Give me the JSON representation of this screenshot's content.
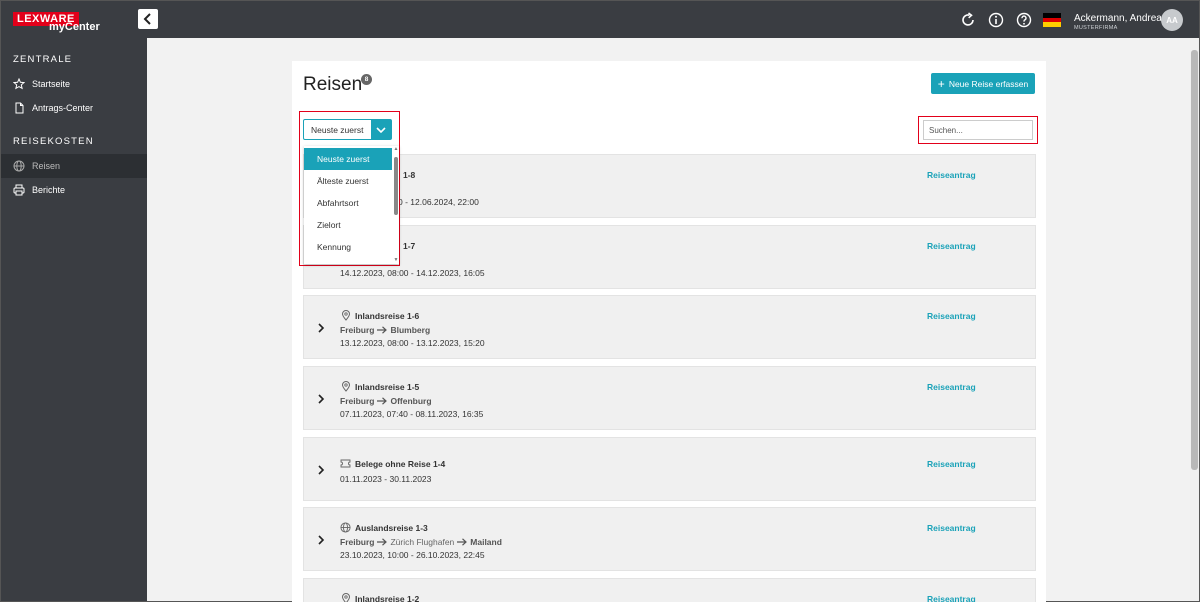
{
  "topbar": {
    "logo_lex": "LEXWARE",
    "logo_my": "myCenter",
    "user_name": "Ackermann, Andrea",
    "user_company": "MUSTERFIRMA",
    "avatar_initials": "AA"
  },
  "sidebar": {
    "section1": "ZENTRALE",
    "startseite": "Startseite",
    "antrags_center": "Antrags-Center",
    "section2": "REISEKOSTEN",
    "reisen": "Reisen",
    "berichte": "Berichte"
  },
  "page": {
    "title": "Reisen",
    "count": "8",
    "new_button": "Neue Reise erfassen"
  },
  "sort": {
    "selected": "Neuste zuerst",
    "options": [
      "Neuste zuerst",
      "Älteste zuerst",
      "Abfahrtsort",
      "Zielort",
      "Kennung"
    ]
  },
  "search": {
    "placeholder": "Suchen..."
  },
  "trips": [
    {
      "name": "1-8",
      "route_from": "",
      "route_to": "",
      "dates": "0 - 12.06.2024, 22:00",
      "link": "Reiseantrag"
    },
    {
      "name": "1-7",
      "route_from": "",
      "route_to": "",
      "dates": "14.12.2023, 08:00 - 14.12.2023, 16:05",
      "link": "Reiseantrag"
    },
    {
      "name": "Inlandsreise 1-6",
      "route_from": "Freiburg",
      "route_to": "Blumberg",
      "dates": "13.12.2023, 08:00 - 13.12.2023, 15:20",
      "link": "Reiseantrag"
    },
    {
      "name": "Inlandsreise 1-5",
      "route_from": "Freiburg",
      "route_to": "Offenburg",
      "dates": "07.11.2023, 07:40 - 08.11.2023, 16:35",
      "link": "Reiseantrag"
    },
    {
      "name": "Belege ohne Reise 1-4",
      "dates": "01.11.2023 - 30.11.2023",
      "link": "Reiseantrag"
    },
    {
      "name": "Auslandsreise 1-3",
      "route_from": "Freiburg",
      "route_via": "Zürich Flughafen",
      "route_to": "Mailand",
      "dates": "23.10.2023, 10:00 - 26.10.2023, 22:45",
      "link": "Reiseantrag"
    },
    {
      "name": "Inlandsreise 1-2",
      "link": "Reiseantrag"
    }
  ],
  "colors": {
    "accent": "#1aa2b8",
    "highlight": "#e2001a",
    "topbar": "#3a3d42"
  }
}
